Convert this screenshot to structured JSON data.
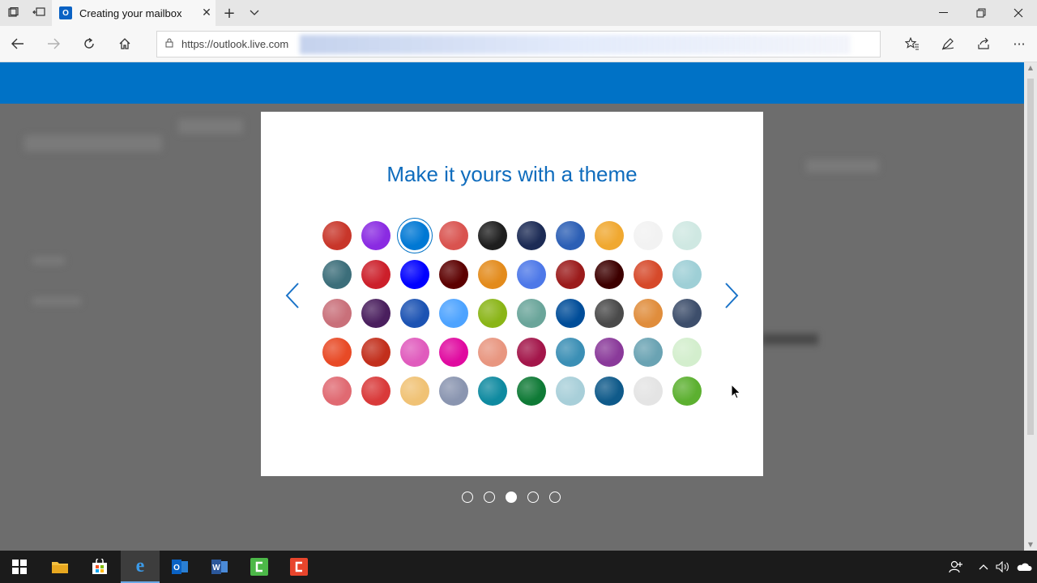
{
  "browser": {
    "tab_title": "Creating your mailbox",
    "tab_favicon_letter": "O",
    "url": "https://outlook.live.com"
  },
  "modal": {
    "title": "Make it yours with a theme",
    "selected_theme_index": 2,
    "swatch_colors": [
      [
        "#c8362a",
        "#8a2be2",
        "#0078d4",
        "#d9534f",
        "#1e1e1e",
        "#1c2b55",
        "#2c5fb5",
        "#f0a830",
        "#f2f2f2",
        "#cfe8e2"
      ],
      [
        "#3c6e7a",
        "#cc1f2a",
        "#0000ff",
        "#5c0000",
        "#e38b1c",
        "#4d78e8",
        "#9b1b1b",
        "#3d0000",
        "#d6492a",
        "#9ecfd6"
      ],
      [
        "#c9707a",
        "#4a1f5e",
        "#1c53b3",
        "#4da3ff",
        "#8ab517",
        "#6aa59a",
        "#004d99",
        "#4a4a4a",
        "#e08d3c",
        "#3d4e6b"
      ],
      [
        "#e84a26",
        "#c22f1c",
        "#e05bbd",
        "#e00aa0",
        "#e89680",
        "#a3164a",
        "#3b8fb5",
        "#8a3a9a",
        "#6aa3b3",
        "#d3eecd"
      ],
      [
        "#e06a72",
        "#d93a3a",
        "#f0c275",
        "#8a95b0",
        "#0f8aa0",
        "#0f7a36",
        "#a8cfd9",
        "#0f5a8a",
        "#e4e4e4",
        "#5cb030"
      ]
    ],
    "pagination": {
      "count": 5,
      "active_index": 2
    }
  },
  "colors": {
    "accent": "#0072c6",
    "title": "#0f6cbd",
    "overlay": "#6d6d6d"
  },
  "taskbar": {
    "apps": [
      "windows-start-icon",
      "file-explorer-icon",
      "store-icon",
      "edge-icon",
      "outlook-icon",
      "word-icon",
      "camtasia-icon",
      "snagit-icon"
    ]
  }
}
